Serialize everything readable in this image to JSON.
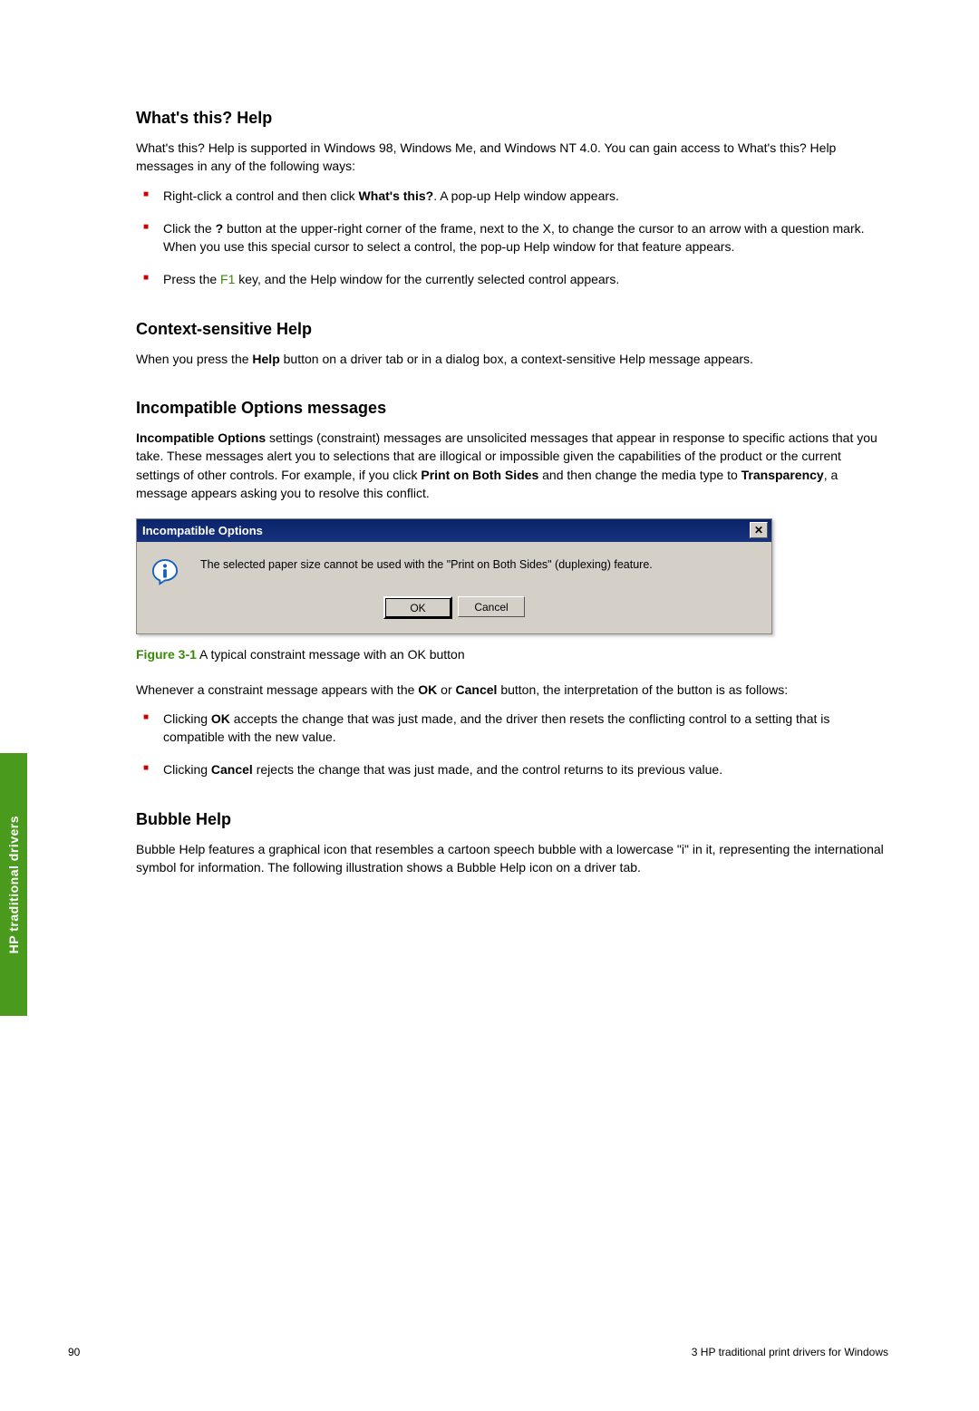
{
  "sideTab": "HP traditional drivers",
  "sections": {
    "whatsThis": {
      "heading": "What's this? Help",
      "intro": "What's this? Help is supported in Windows 98, Windows Me, and Windows NT 4.0. You can gain access to What's this? Help messages in any of the following ways:",
      "b1_a": "Right-click a control and then click ",
      "b1_bold": "What's this?",
      "b1_b": ". A pop-up Help window appears.",
      "b2_a": "Click the ",
      "b2_bold": "?",
      "b2_b": " button at the upper-right corner of the frame, next to the X, to change the cursor to an arrow with a question mark. When you use this special cursor to select a control, the pop-up Help window for that feature appears.",
      "b3_a": "Press the ",
      "b3_green": "F1",
      "b3_b": " key, and the Help window for the currently selected control appears."
    },
    "context": {
      "heading": "Context-sensitive Help",
      "p_a": "When you press the ",
      "p_bold": "Help",
      "p_b": " button on a driver tab or in a dialog box, a context-sensitive Help message appears."
    },
    "incompat": {
      "heading": "Incompatible Options messages",
      "p_b1": "Incompatible Options",
      "p_a": " settings (constraint) messages are unsolicited messages that appear in response to specific actions that you take. These messages alert you to selections that are illogical or impossible given the capabilities of the product or the current settings of other controls. For example, if you click ",
      "p_b2": "Print on Both Sides",
      "p_b": " and then change the media type to ",
      "p_b3": "Transparency",
      "p_c": ", a message appears asking you to resolve this conflict.",
      "dialog": {
        "title": "Incompatible Options",
        "message": "The selected paper size cannot be used with the \"Print on Both Sides\" (duplexing) feature.",
        "ok": "OK",
        "cancel": "Cancel"
      },
      "figLabel": "Figure 3-1",
      "figText": "  A typical constraint message with an OK button",
      "after_a": "Whenever a constraint message appears with the ",
      "after_b1": "OK",
      "after_mid": " or ",
      "after_b2": "Cancel",
      "after_b": " button, the interpretation of the button is as follows:",
      "li1_a": "Clicking ",
      "li1_bold": "OK",
      "li1_b": " accepts the change that was just made, and the driver then resets the conflicting control to a setting that is compatible with the new value.",
      "li2_a": "Clicking ",
      "li2_bold": "Cancel",
      "li2_b": " rejects the change that was just made, and the control returns to its previous value."
    },
    "bubble": {
      "heading": "Bubble Help",
      "text": "Bubble Help features a graphical icon that resembles a cartoon speech bubble with a lowercase \"i\" in it, representing the international symbol for information. The following illustration shows a Bubble Help icon on a driver tab."
    }
  },
  "footer": {
    "pageNum": "90",
    "chapter": "3   HP traditional print drivers for Windows"
  }
}
